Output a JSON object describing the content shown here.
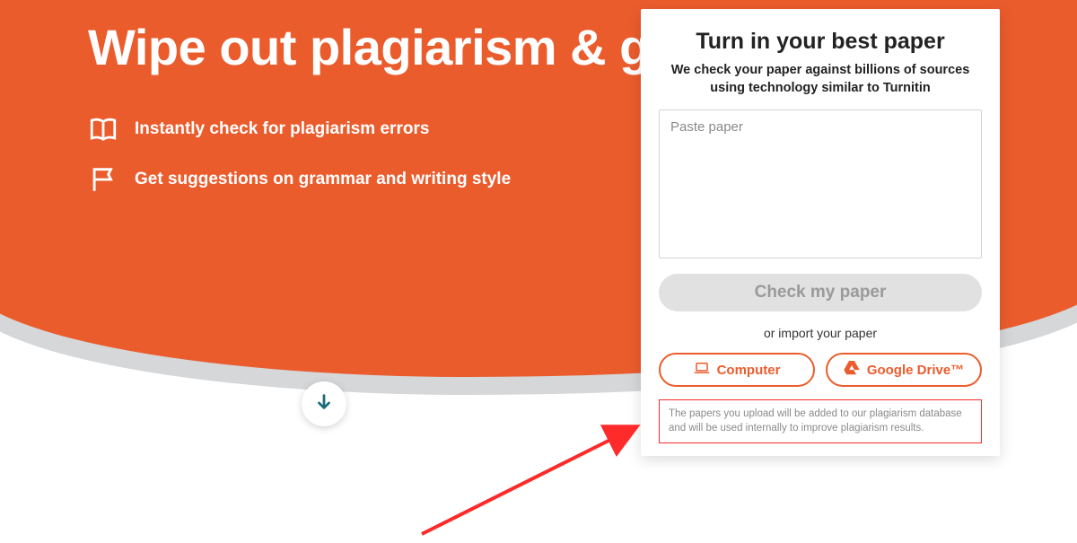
{
  "hero": {
    "headline": "Wipe out plagiarism & grammar errors",
    "bullets": [
      {
        "text": "Instantly check for plagiarism errors",
        "icon": "book-open-icon"
      },
      {
        "text": "Get suggestions on grammar and writing style",
        "icon": "flag-icon"
      }
    ]
  },
  "card": {
    "title": "Turn in your best paper",
    "subtitle": "We check your paper against billions of sources using technology similar to Turnitin",
    "textarea_placeholder": "Paste paper",
    "check_button": "Check my paper",
    "or_import": "or import your paper",
    "import_computer": "Computer",
    "import_drive": "Google Drive™",
    "disclaimer": "The papers you upload will be added to our plagiarism database and will be used internally to improve plagiarism results."
  },
  "colors": {
    "brand_orange": "#eb5c2d",
    "annotation_red": "#ff2a2a",
    "scroll_arrow": "#1b6a7a"
  }
}
